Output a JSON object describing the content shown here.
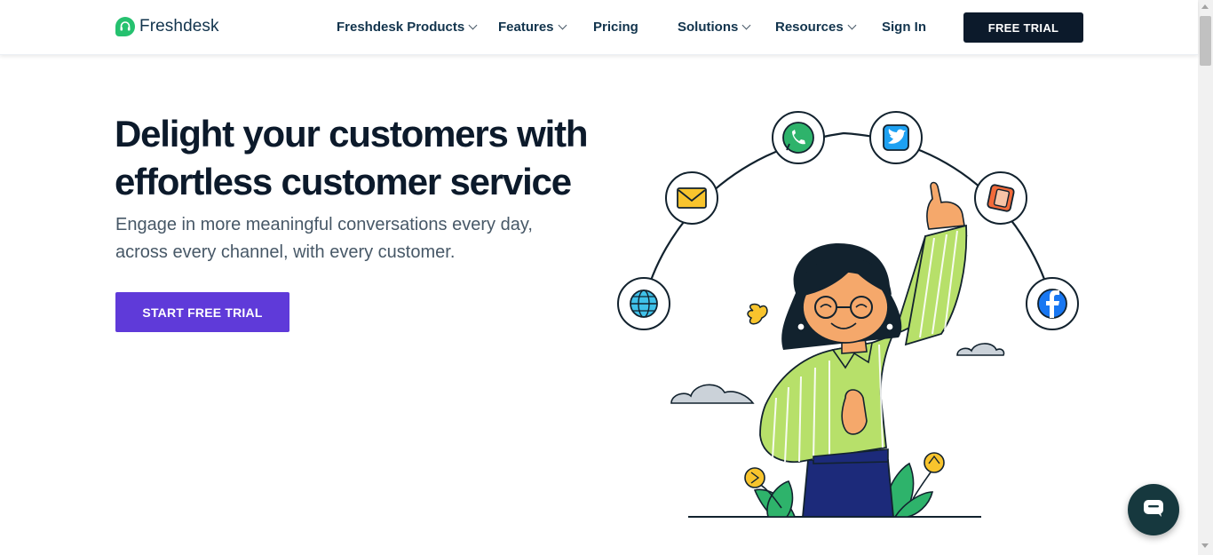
{
  "header": {
    "logo_text": "Freshdesk",
    "nav": [
      {
        "label": "Freshdesk Products",
        "has_dropdown": true
      },
      {
        "label": "Features",
        "has_dropdown": true
      },
      {
        "label": "Pricing",
        "has_dropdown": false
      },
      {
        "label": "Solutions",
        "has_dropdown": true
      },
      {
        "label": "Resources",
        "has_dropdown": true
      },
      {
        "label": "Sign In",
        "has_dropdown": false
      }
    ],
    "cta_label": "FREE TRIAL"
  },
  "hero": {
    "title": "Delight your customers with effortless customer service",
    "subtitle": "Engage in more meaningful conversations every day, across every channel, with every customer.",
    "cta_label": "START FREE TRIAL"
  },
  "illustration": {
    "channel_icons": [
      "globe-icon",
      "email-icon",
      "whatsapp-icon",
      "twitter-icon",
      "mobile-icon",
      "facebook-icon"
    ]
  },
  "chat_widget": {
    "icon": "chat-icon"
  },
  "colors": {
    "brand_green": "#25c16f",
    "primary_dark": "#0c1a2b",
    "cta_purple": "#5f3ad9",
    "shirt_green": "#b7e06a",
    "chat_widget_bg": "#16383e"
  }
}
